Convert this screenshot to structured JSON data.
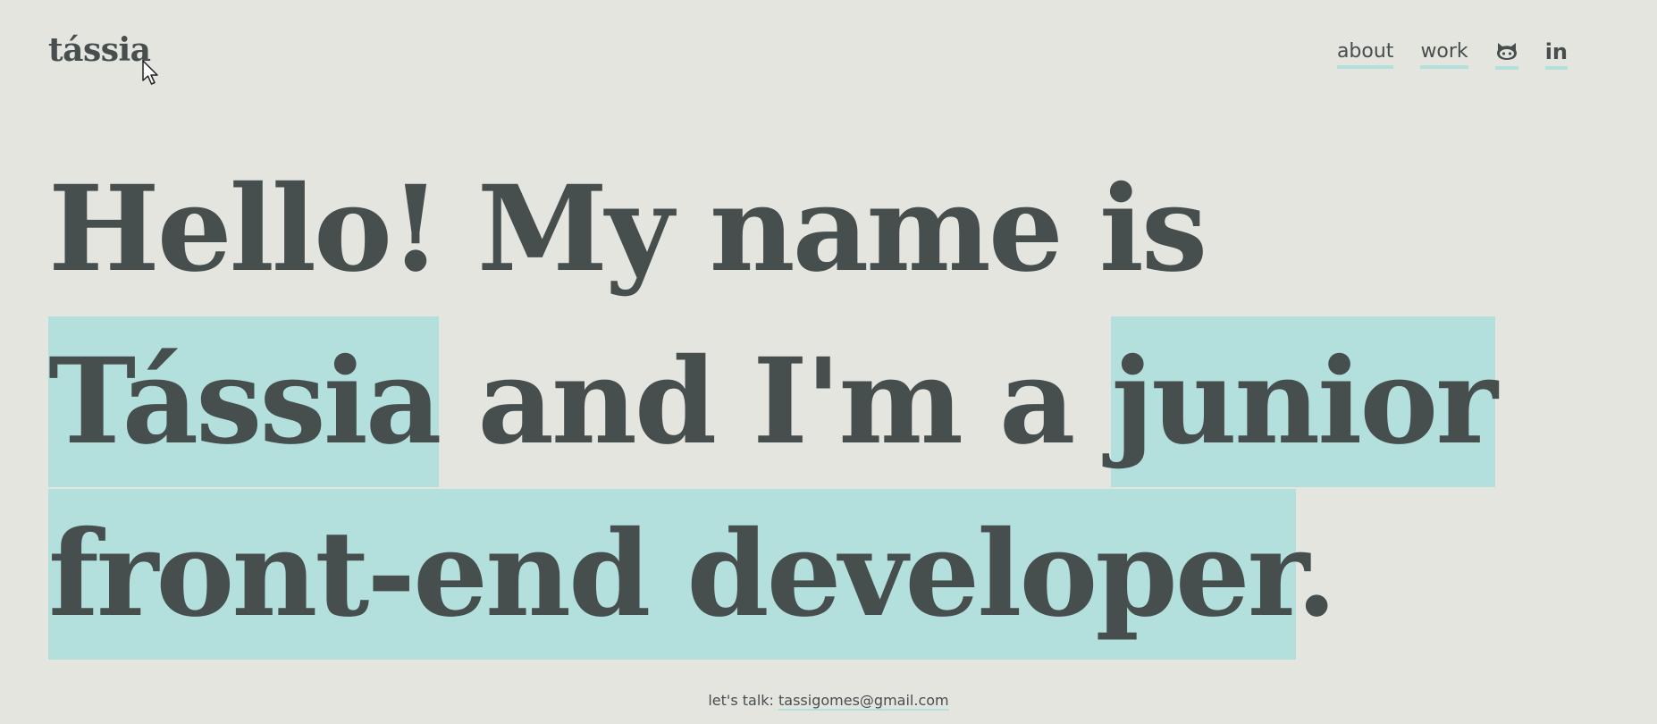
{
  "brand": {
    "logo_text": "tássia"
  },
  "nav": {
    "links": [
      {
        "label": "about"
      },
      {
        "label": "work"
      }
    ],
    "icons": [
      {
        "name": "github-icon"
      },
      {
        "name": "linkedin-icon",
        "glyph": "in"
      }
    ]
  },
  "hero": {
    "part1": "Hello! My name is ",
    "name": "Tássia",
    "part2": " and I'm a ",
    "role": "junior front-end developer",
    "end": "."
  },
  "footer": {
    "prefix": "let's talk: ",
    "email": "tassigomes@gmail.com"
  },
  "colors": {
    "background": "#e5e5e0",
    "text": "#464e4e",
    "highlight": "#b3dfdd"
  }
}
